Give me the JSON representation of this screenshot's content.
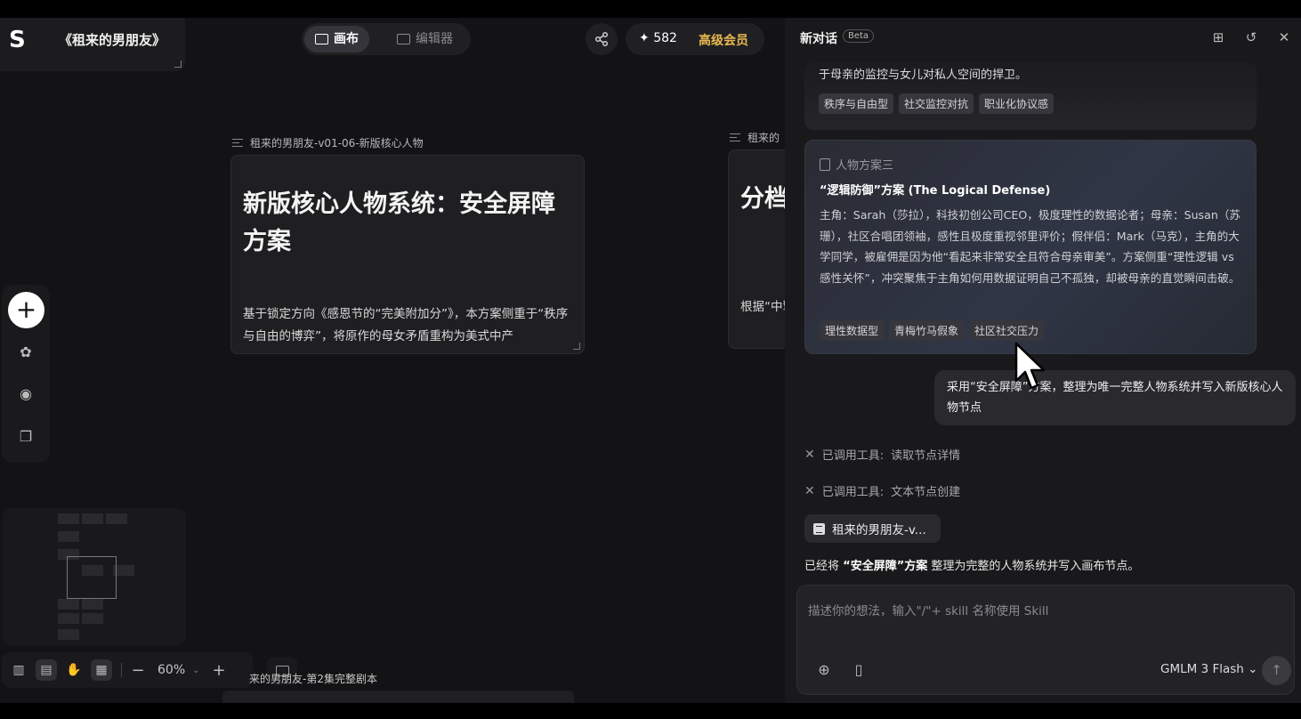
{
  "project": {
    "title": "《租来的男朋友》"
  },
  "modes": {
    "canvas_label": "画布",
    "editor_label": "编辑器"
  },
  "credits": {
    "value": "582",
    "member_label": "高级会员"
  },
  "nodes": {
    "main_header": "租来的男朋友-v01-06-新版核心人物",
    "main_title": "新版核心人物系统：安全屏障方案",
    "main_body": "基于锁定方向《感恩节的“完美附加分”》，本方案侧重于“秩序与自由的博弈”，将原作的母女矛盾重构为美式中产",
    "side_header": "租来的",
    "side_title": "分档变｜",
    "side_body": "根据“中擎、五个",
    "bottom_label": "来的男朋友-第2集完整剧本"
  },
  "zoom": {
    "value": "60%"
  },
  "chat": {
    "title": "新对话",
    "beta": "Beta",
    "plan2": {
      "text": "于母亲的监控与女儿对私人空间的捍卫。",
      "tags": [
        "秩序与自由型",
        "社交监控对抗",
        "职业化协议感"
      ]
    },
    "plan3": {
      "label": "人物方案三",
      "name": "“逻辑防御”方案 (The Logical Defense)",
      "desc": "主角：Sarah（莎拉），科技初创公司CEO，极度理性的数据论者；母亲：Susan（苏珊），社区合唱团领袖，感性且极度重视邻里评价；假伴侣：Mark（马克），主角的大学同学，被雇佣是因为他“看起来非常安全且符合母亲审美”。方案侧重“理性逻辑 vs 感性关怀”，冲突聚焦于主角如何用数据证明自己不孤独，却被母亲的直觉瞬间击破。",
      "tags": [
        "理性数据型",
        "青梅竹马假象",
        "社区社交压力"
      ]
    },
    "user_message": "采用“安全屏障”方案，整理为唯一完整人物系统并写入新版核心人物节点",
    "tool_prefix": "已调用工具:",
    "tool1": "读取节点详情",
    "tool2": "文本节点创建",
    "doc_chip": "租来的男朋友-v...",
    "summary_prefix": "已经将",
    "summary_bold": "“安全屏障”方案",
    "summary_suffix": "整理为完整的人物系统并写入画布节点。",
    "input_placeholder": "描述你的想法，输入\"/\"+ skill 名称使用 Skill",
    "model": "GMLM 3 Flash"
  },
  "colors": {
    "accent_member": "#e9b84f",
    "panel_bg": "#19191b",
    "canvas_bg": "#131315"
  },
  "icons": [
    "logo-icon",
    "canvas-icon",
    "editor-icon",
    "share-icon",
    "sparkle-icon",
    "add-icon",
    "assets-icon",
    "character-icon",
    "copy-icon",
    "layout-icon",
    "map-icon",
    "hand-icon",
    "select-icon",
    "comment-icon",
    "new-chat-icon",
    "history-icon",
    "close-icon",
    "clipboard-icon",
    "tool-icon",
    "document-icon",
    "attach-icon",
    "book-icon",
    "send-icon",
    "cursor-icon"
  ]
}
